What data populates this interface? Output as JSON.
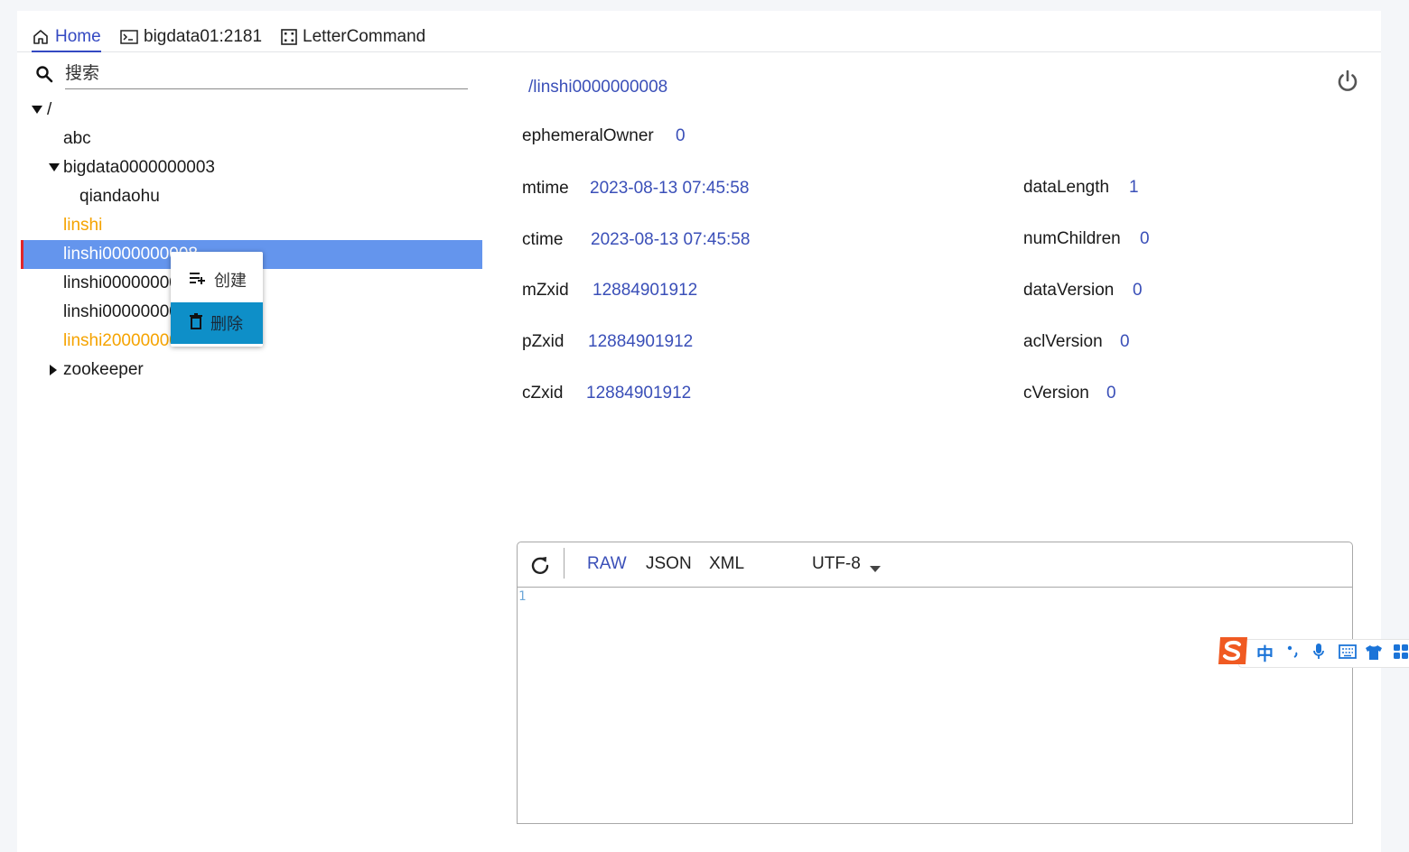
{
  "tabs": [
    {
      "label": "Home",
      "icon": "home-icon",
      "active": true
    },
    {
      "label": "bigdata01:2181",
      "icon": "terminal-icon",
      "active": false
    },
    {
      "label": "LetterCommand",
      "icon": "command-icon",
      "active": false
    }
  ],
  "search": {
    "placeholder": "搜索"
  },
  "tree": {
    "root": "/",
    "items": [
      {
        "label": "abc",
        "color": "default"
      },
      {
        "label": "bigdata0000000003",
        "expanded": true,
        "color": "default"
      },
      {
        "label": "qiandaohu",
        "color": "default"
      },
      {
        "label": "linshi",
        "color": "#f5a300"
      },
      {
        "label": "linshi0000000008",
        "selected": true,
        "color": "default"
      },
      {
        "label": "linshi0000000009",
        "color": "default"
      },
      {
        "label": "linshi0000000010",
        "color": "default"
      },
      {
        "label": "linshi2000000011",
        "color": "#f5a300"
      },
      {
        "label": "zookeeper",
        "expanded": false,
        "color": "default"
      }
    ]
  },
  "context_menu": {
    "create_label": "创建",
    "delete_label": "删除"
  },
  "detail": {
    "path": "/linshi0000000008",
    "stats": {
      "ephemeralOwner": {
        "label": "ephemeralOwner",
        "value": "0"
      },
      "mtime": {
        "label": "mtime",
        "value": "2023-08-13 07:45:58"
      },
      "ctime": {
        "label": "ctime",
        "value": "2023-08-13 07:45:58"
      },
      "mZxid": {
        "label": "mZxid",
        "value": "12884901912"
      },
      "pZxid": {
        "label": "pZxid",
        "value": "12884901912"
      },
      "cZxid": {
        "label": "cZxid",
        "value": "12884901912"
      },
      "dataLength": {
        "label": "dataLength",
        "value": "1"
      },
      "numChildren": {
        "label": "numChildren",
        "value": "0"
      },
      "dataVersion": {
        "label": "dataVersion",
        "value": "0"
      },
      "aclVersion": {
        "label": "aclVersion",
        "value": "0"
      },
      "cVersion": {
        "label": "cVersion",
        "value": "0"
      }
    }
  },
  "editor": {
    "formats": [
      "RAW",
      "JSON",
      "XML"
    ],
    "active_format": "RAW",
    "encoding": "UTF-8",
    "line_number": "1"
  },
  "ime": {
    "mode": "中"
  },
  "colors": {
    "accent": "#3449c2",
    "link": "#3a4fb8",
    "selected_bg": "#6495ed",
    "orange_node": "#f5a300",
    "menu_hover": "#0e8fc8"
  }
}
